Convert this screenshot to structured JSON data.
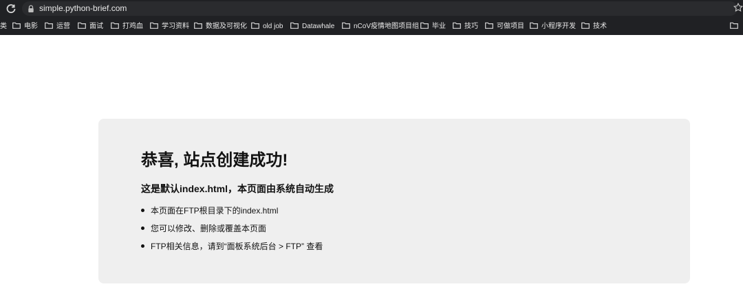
{
  "browser": {
    "url": "simple.python-brief.com",
    "bookmarks": [
      "类",
      "电影",
      "运营",
      "面试",
      "打鸡血",
      "学习资料",
      "数据及可视化",
      "old job",
      "Datawhale",
      "nCoV疫情地图项目组",
      "毕业",
      "技巧",
      "可做项目",
      "小程序开发",
      "技术"
    ]
  },
  "page": {
    "title": "恭喜, 站点创建成功!",
    "subtitle": "这是默认index.html，本页面由系统自动生成",
    "items": [
      "本页面在FTP根目录下的index.html",
      "您可以修改、删除或覆盖本页面",
      "FTP相关信息，请到“面板系统后台 > FTP” 查看"
    ]
  }
}
